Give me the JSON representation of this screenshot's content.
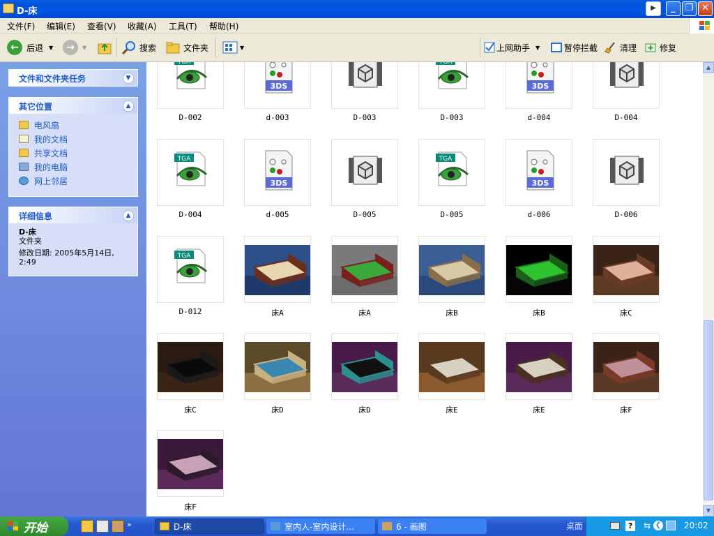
{
  "window": {
    "title": "D-床"
  },
  "menubar": [
    "文件(F)",
    "编辑(E)",
    "查看(V)",
    "收藏(A)",
    "工具(T)",
    "帮助(H)"
  ],
  "toolbar": {
    "back": "后退",
    "search": "搜索",
    "folders": "文件夹",
    "assistant": "上网助手",
    "block": "暂停拦截",
    "clean": "清理",
    "repair": "修复"
  },
  "leftpane": {
    "tasks": {
      "title": "文件和文件夹任务"
    },
    "places": {
      "title": "其它位置",
      "items": [
        "电风扇",
        "我的文档",
        "共享文档",
        "我的电脑",
        "网上邻居"
      ]
    },
    "details": {
      "title": "详细信息",
      "name": "D-床",
      "type": "文件夹",
      "modified": "修改日期: 2005年5月14日, 2:49"
    }
  },
  "files": [
    {
      "name": "D-002",
      "kind": "tga"
    },
    {
      "name": "d-003",
      "kind": "3ds"
    },
    {
      "name": "D-003",
      "kind": "max"
    },
    {
      "name": "D-003",
      "kind": "tga"
    },
    {
      "name": "d-004",
      "kind": "3ds"
    },
    {
      "name": "D-004",
      "kind": "max"
    },
    {
      "name": "D-004",
      "kind": "tga"
    },
    {
      "name": "d-005",
      "kind": "3ds"
    },
    {
      "name": "D-005",
      "kind": "max"
    },
    {
      "name": "D-005",
      "kind": "tga"
    },
    {
      "name": "d-006",
      "kind": "3ds"
    },
    {
      "name": "D-006",
      "kind": "max"
    },
    {
      "name": "D-012",
      "kind": "tga"
    },
    {
      "name": "床A",
      "kind": "photo",
      "bg": "#2c4f8a",
      "floor": "#1e3a6b",
      "bed": "#e6d7b0",
      "frame": "#6b2e1c"
    },
    {
      "name": "床A",
      "kind": "photo",
      "bg": "#7a7a7a",
      "floor": "#6c6c6c",
      "bed": "#3aa83a",
      "frame": "#7a1e1e"
    },
    {
      "name": "床B",
      "kind": "photo",
      "bg": "#3b5f95",
      "floor": "#2a4a7e",
      "bed": "#d8c9a8",
      "frame": "#8a6e4a"
    },
    {
      "name": "床B",
      "kind": "photo",
      "bg": "#000000",
      "floor": "#050505",
      "bed": "#2ec22e",
      "frame": "#1b5e1b"
    },
    {
      "name": "床C",
      "kind": "photo",
      "bg": "#3a2418",
      "floor": "#5c3a24",
      "bed": "#e0b09a",
      "frame": "#6b3a24"
    },
    {
      "name": "床C",
      "kind": "photo",
      "bg": "#2a1a10",
      "floor": "#3a2416",
      "bed": "#0a0a0a",
      "frame": "#1a1a1a"
    },
    {
      "name": "床D",
      "kind": "photo",
      "bg": "#5a4a2a",
      "floor": "#8a7040",
      "bed": "#3a88b0",
      "frame": "#c8b080"
    },
    {
      "name": "床D",
      "kind": "photo",
      "bg": "#4a1a4a",
      "floor": "#5a2a5a",
      "bed": "#111111",
      "frame": "#2a9090"
    },
    {
      "name": "床E",
      "kind": "photo",
      "bg": "#5a3a1e",
      "floor": "#8a5a2e",
      "bed": "#d8d0c0",
      "frame": "#5a3a1e"
    },
    {
      "name": "床E",
      "kind": "photo",
      "bg": "#4a1a4a",
      "floor": "#5a2a5a",
      "bed": "#d8d0c0",
      "frame": "#4a3020"
    },
    {
      "name": "床F",
      "kind": "photo",
      "bg": "#3a2418",
      "floor": "#5a3a26",
      "bed": "#c0909a",
      "frame": "#7a3a26"
    },
    {
      "name": "床F",
      "kind": "photo",
      "bg": "#3a1a3a",
      "floor": "#5a2a5a",
      "bed": "#c8a0b8",
      "frame": "#2a1a2a"
    }
  ],
  "taskbar": {
    "start": "开始",
    "tasks": [
      "D-床",
      "室内人-室内设计...",
      "6 - 画图"
    ],
    "desktop": "桌面",
    "clock": "20:02"
  }
}
